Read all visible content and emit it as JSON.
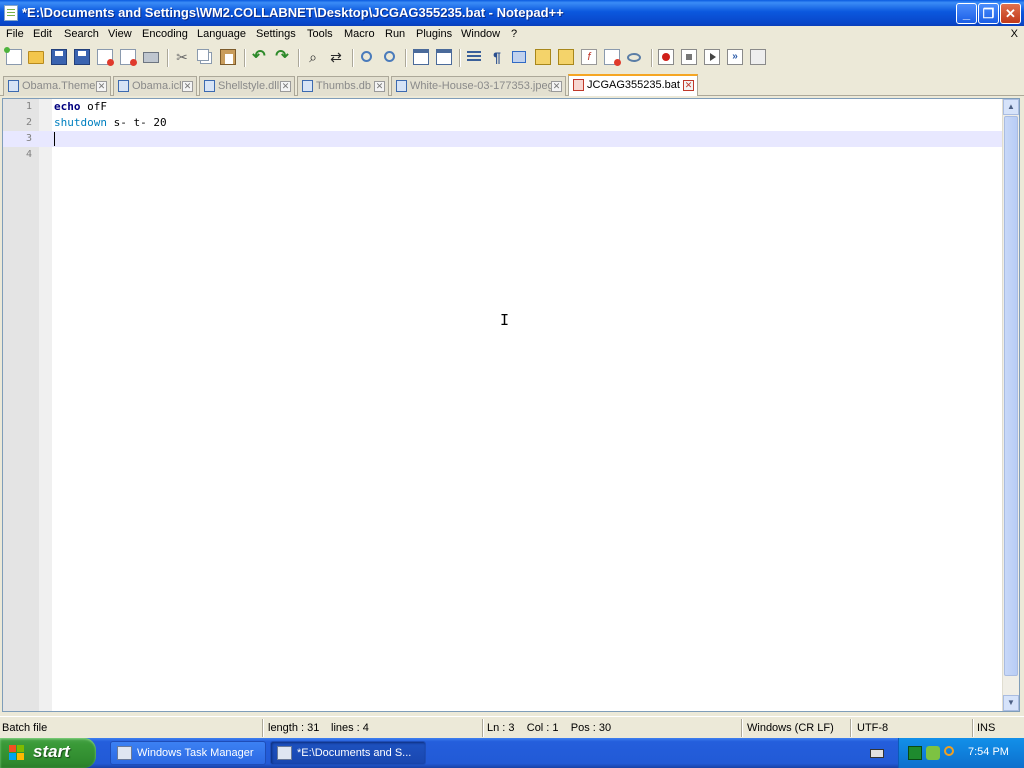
{
  "window": {
    "title": "*E:\\Documents and Settings\\WM2.COLLABNET\\Desktop\\JCGAG355235.bat - Notepad++",
    "minimize": "_",
    "maximize": "❐",
    "close": "✕"
  },
  "menu": {
    "items": [
      "File",
      "Edit",
      "Search",
      "View",
      "Encoding",
      "Language",
      "Settings",
      "Tools",
      "Macro",
      "Run",
      "Plugins",
      "Window",
      "?"
    ],
    "close_x": "X"
  },
  "tabs": [
    {
      "label": "Obama.Theme",
      "active": false
    },
    {
      "label": "Obama.icl",
      "active": false
    },
    {
      "label": "Shellstyle.dll",
      "active": false
    },
    {
      "label": "Thumbs.db",
      "active": false
    },
    {
      "label": "White-House-03-177353.jpeg",
      "active": false
    },
    {
      "label": "JCGAG355235.bat",
      "active": true
    }
  ],
  "editor": {
    "lines": [
      {
        "num": "1",
        "keyword": "echo",
        "rest": " ofF"
      },
      {
        "num": "2",
        "keyword": "shutdown",
        "rest": " s- t- 20"
      },
      {
        "num": "3",
        "keyword": "",
        "rest": ""
      },
      {
        "num": "4",
        "keyword": "",
        "rest": ""
      }
    ],
    "current_line": 3
  },
  "status": {
    "file_type": "Batch file",
    "length": "length : 31",
    "lines": "lines : 4",
    "position": "Ln : 3    Col : 1    Pos : 30",
    "eol": "Windows (CR LF)",
    "encoding": "UTF-8",
    "mode": "INS"
  },
  "taskbar": {
    "start_label": "start",
    "tasks": [
      {
        "label": "Windows Task Manager",
        "active": false
      },
      {
        "label": "*E:\\Documents and S...",
        "active": true
      }
    ],
    "clock": "7:54 PM"
  }
}
